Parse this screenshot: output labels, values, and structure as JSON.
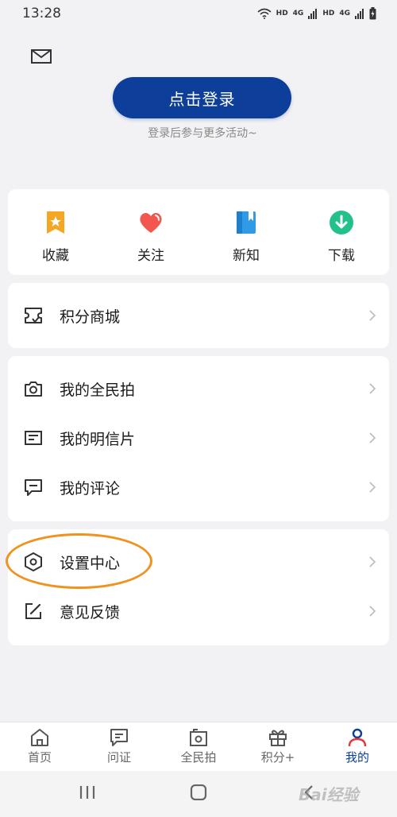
{
  "status": {
    "time": "13:28",
    "hd1": "HD",
    "hd2": "HD",
    "net1": "4G",
    "net2": "4G"
  },
  "header": {
    "mail_icon": "mail-icon"
  },
  "login": {
    "button_label": "点击登录",
    "hint": "登录后参与更多活动~"
  },
  "quick": {
    "items": [
      {
        "label": "收藏",
        "icon": "favorite-star-icon",
        "color": "#f5a623"
      },
      {
        "label": "关注",
        "icon": "heart-icon",
        "color": "#f2564e"
      },
      {
        "label": "新知",
        "icon": "book-icon",
        "color": "#2f9be6"
      },
      {
        "label": "下载",
        "icon": "download-icon",
        "color": "#22c08a"
      }
    ]
  },
  "menu": {
    "mall": {
      "label": "积分商城",
      "icon": "points-mall-icon"
    },
    "group2": [
      {
        "label": "我的全民拍",
        "icon": "camera-icon"
      },
      {
        "label": "我的明信片",
        "icon": "postcard-icon"
      },
      {
        "label": "我的评论",
        "icon": "comment-icon"
      }
    ],
    "group3": [
      {
        "label": "设置中心",
        "icon": "settings-hexagon-icon"
      },
      {
        "label": "意见反馈",
        "icon": "feedback-edit-icon"
      }
    ]
  },
  "tabs": [
    {
      "label": "首页",
      "icon": "home-icon"
    },
    {
      "label": "问证",
      "icon": "chat-flag-icon"
    },
    {
      "label": "全民拍",
      "icon": "photo-icon"
    },
    {
      "label": "积分+",
      "icon": "gift-icon"
    },
    {
      "label": "我的",
      "icon": "profile-icon",
      "active": true
    }
  ],
  "colors": {
    "accent": "#0d3e9a",
    "highlight_ring": "#f0921e"
  },
  "watermark": "Bai经验"
}
